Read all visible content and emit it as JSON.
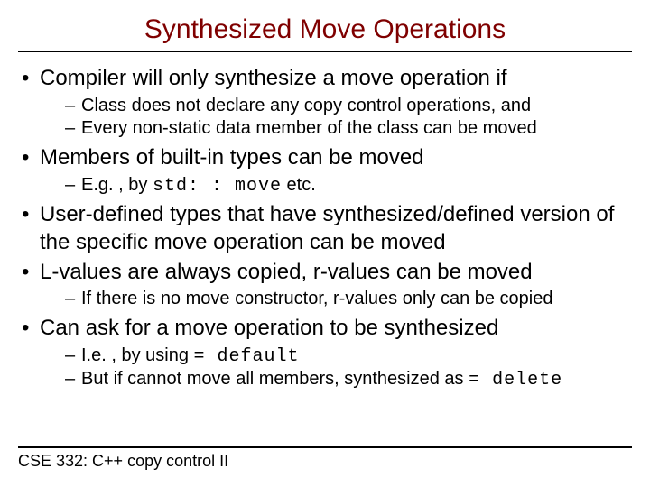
{
  "title": "Synthesized Move Operations",
  "bullets": {
    "b0": "Compiler will only synthesize a move operation if",
    "b0s0": "Class does not declare any copy control operations, and",
    "b0s1": "Every non-static data member of the class can be moved",
    "b1": "Members of built-in types can be moved",
    "b1s0a": "E.g. , by ",
    "b1s0code": "std: : move",
    "b1s0b": " etc.",
    "b2": "User-defined types that have synthesized/defined version of the specific move operation can be moved",
    "b3": "L-values are always copied, r-values can be moved",
    "b3s0": "If there is no move constructor, r-values only can be copied",
    "b4": "Can ask for a move operation to be synthesized",
    "b4s0a": "I.e. , by using ",
    "b4s0code": "= default",
    "b4s1a": "But if cannot move all members, synthesized as ",
    "b4s1code": "= delete"
  },
  "footer": "CSE 332: C++ copy control II"
}
